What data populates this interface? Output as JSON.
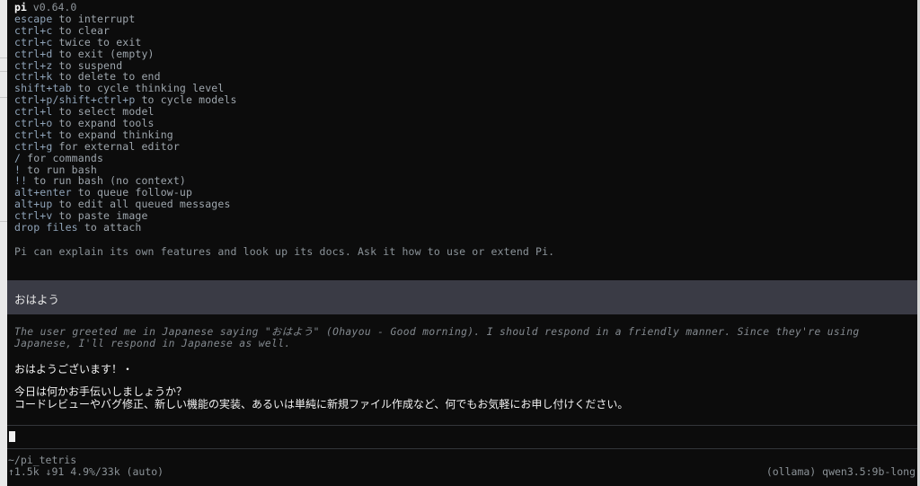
{
  "app": {
    "name": "pi",
    "version": "v0.64.0"
  },
  "help": {
    "lines": [
      {
        "key": "escape",
        "desc": " to interrupt"
      },
      {
        "key": "ctrl+c",
        "desc": " to clear"
      },
      {
        "key": "ctrl+c",
        "desc": " twice to exit"
      },
      {
        "key": "ctrl+d",
        "desc": " to exit (empty)"
      },
      {
        "key": "ctrl+z",
        "desc": " to suspend"
      },
      {
        "key": "ctrl+k",
        "desc": " to delete to end"
      },
      {
        "key": "shift+tab",
        "desc": " to cycle thinking level"
      },
      {
        "key": "ctrl+p/shift+ctrl+p",
        "desc": " to cycle models"
      },
      {
        "key": "ctrl+l",
        "desc": " to select model"
      },
      {
        "key": "ctrl+o",
        "desc": " to expand tools"
      },
      {
        "key": "ctrl+t",
        "desc": " to expand thinking"
      },
      {
        "key": "ctrl+g",
        "desc": " for external editor"
      },
      {
        "key": "/",
        "desc": " for commands"
      },
      {
        "key": "!",
        "desc": " to run bash"
      },
      {
        "key": "!!",
        "desc": " to run bash (no context)"
      },
      {
        "key": "alt+enter",
        "desc": " to queue follow-up"
      },
      {
        "key": "alt+up",
        "desc": " to edit all queued messages"
      },
      {
        "key": "ctrl+v",
        "desc": " to paste image"
      },
      {
        "key": "drop files",
        "desc": " to attach"
      }
    ],
    "note": "Pi can explain its own features and look up its docs. Ask it how to use or extend Pi."
  },
  "conversation": {
    "user_message": "おはよう",
    "thinking": "The user greeted me in Japanese saying \"おはよう\" (Ohayou - Good morning). I should respond in a friendly manner. Since they're using Japanese, I'll respond in Japanese as well.",
    "reply_line1": "おはようございます！・",
    "reply_line2": "今日は何かお手伝いしましょうか？",
    "reply_line3": "コードレビューやバグ修正、新しい機能の実装、あるいは単純に新規ファイル作成など、何でもお気軽にお申し付けください。"
  },
  "status": {
    "path": "~/pi_tetris",
    "stats": "↑1.5k ↓91 4.9%/33k (auto)",
    "model": "(ollama) qwen3.5:9b-long"
  }
}
